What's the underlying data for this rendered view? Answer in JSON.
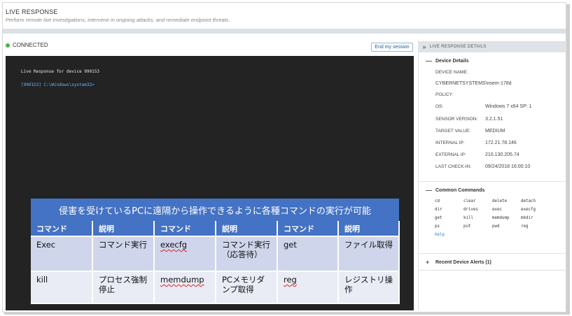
{
  "header": {
    "title": "LIVE RESPONSE",
    "subtitle": "Perform remote live investigations, intervene in ongoing attacks, and remediate endpoint threats."
  },
  "session": {
    "status": "CONNECTED",
    "status_color": "#4caf50",
    "end_button_label": "End my session"
  },
  "terminal": {
    "line1": "Live Response for device 990153",
    "line2": "[990153] C:\\Windows\\system32>"
  },
  "overlay": {
    "banner": "侵害を受けているPCに遠隔から操作できるように各種コマンドの実行が可能",
    "headers": [
      "コマンド",
      "説明",
      "コマンド",
      "説明",
      "コマンド",
      "説明"
    ],
    "rows": [
      [
        "Exec",
        "コマンド実行",
        "execfg",
        "コマンド実行（応答待）",
        "get",
        "ファイル取得"
      ],
      [
        "kill",
        "プロセス強制停止",
        "memdump",
        "PCメモリダンプ取得",
        "reg",
        "レジストリ操作"
      ]
    ],
    "accent_color": "#4472c4"
  },
  "panel": {
    "title": "LIVE RESPONSE DETAILS",
    "device_details": {
      "heading": "Device Details",
      "toggle": "—",
      "device_name_label": "DEVICE NAME:",
      "device_name": "CYBERNETSYSTEMS\\nsem-178d",
      "policy_label": "POLICY:",
      "policy": "",
      "os_label": "OS:",
      "os": "Windows 7 x64 SP: 1",
      "sensor_version_label": "SENSOR VERSION:",
      "sensor_version": "3.2.1.51",
      "target_value_label": "TARGET VALUE:",
      "target_value": "MEDIUM",
      "internal_ip_label": "INTERNAL IP:",
      "internal_ip": "172.21.78.146",
      "external_ip_label": "EXTERNAL IP:",
      "external_ip": "210.130.205.74",
      "last_checkin_label": "LAST CHECK-IN:",
      "last_checkin": "09/24/2018 16:00:10"
    },
    "common_commands": {
      "heading": "Common Commands",
      "toggle": "—",
      "items": [
        "cd",
        "clear",
        "delete",
        "detach",
        "dir",
        "drives",
        "exec",
        "execfg",
        "get",
        "kill",
        "memdump",
        "mkdir",
        "ps",
        "put",
        "pwd",
        "reg",
        "help"
      ]
    },
    "recent_alerts": {
      "heading": "Recent Device Alerts (1)",
      "toggle": "+"
    }
  }
}
